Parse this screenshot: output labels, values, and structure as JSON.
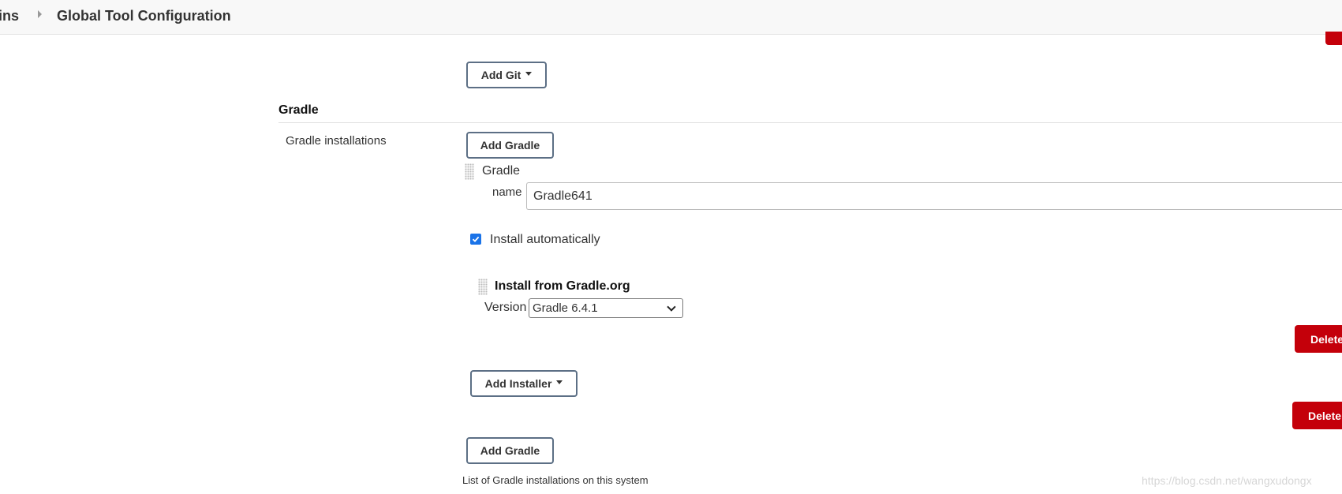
{
  "breadcrumb": {
    "item_partial": "ins",
    "current": "Global Tool Configuration"
  },
  "git": {
    "add_button": "Add Git"
  },
  "gradle": {
    "section_title": "Gradle",
    "installations_label": "Gradle installations",
    "add_button_top": "Add Gradle",
    "item_header": "Gradle",
    "name_label": "name",
    "name_value": "Gradle641",
    "install_auto_label": "Install automatically",
    "install_auto_checked": true,
    "installer_title": "Install from Gradle.org",
    "version_label": "Version",
    "version_value": "Gradle 6.4.1",
    "delete_installer_label": "Delete",
    "add_installer_button": "Add Installer",
    "delete_gradle_label": "Delete",
    "add_button_bottom": "Add Gradle",
    "help_text": "List of Gradle installations on this system"
  },
  "watermark": "https://blog.csdn.net/wangxudongx",
  "colors": {
    "danger": "#c4000a",
    "checkbox": "#1a73e8",
    "button_border": "#5c6f85"
  }
}
